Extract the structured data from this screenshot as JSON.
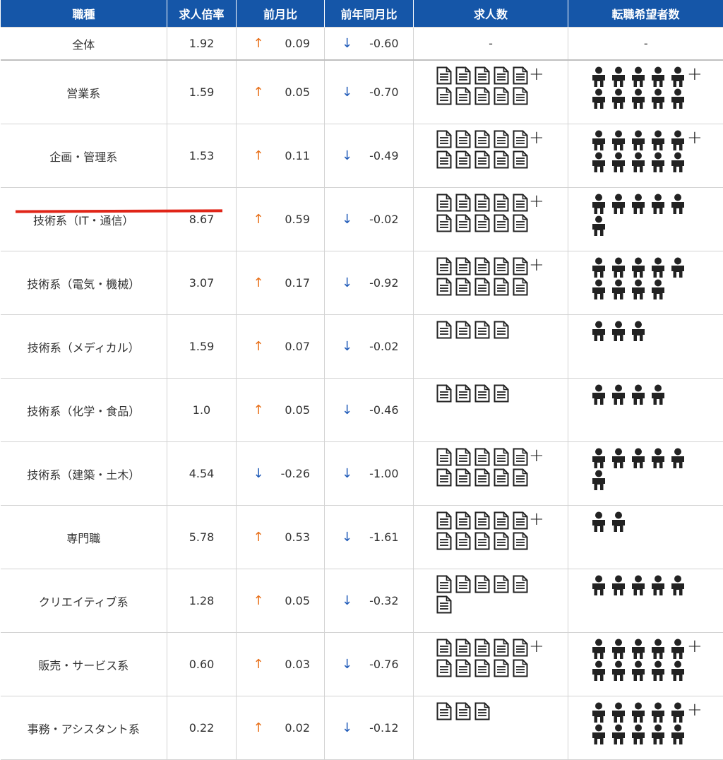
{
  "headers": {
    "job_type": "職種",
    "ratio": "求人倍率",
    "mom": "前月比",
    "yoy": "前年同月比",
    "openings": "求人数",
    "applicants": "転職希望者数"
  },
  "plus_sign": "+",
  "dash": "-",
  "rows": [
    {
      "name": "全体",
      "ratio": "1.92",
      "mom_dir": "up",
      "mom_arrow": "↑",
      "mom": "0.09",
      "yoy_dir": "down",
      "yoy_arrow": "↓",
      "yoy": "-0.60",
      "docs": "-",
      "people": "-"
    },
    {
      "name": "営業系",
      "ratio": "1.59",
      "mom_arrow": "↑",
      "mom": "0.05",
      "yoy_arrow": "↓",
      "yoy": "-0.70",
      "docs": 10,
      "docs_plus": true,
      "people": 10,
      "people_plus": true
    },
    {
      "name": "企画・管理系",
      "ratio": "1.53",
      "mom_arrow": "↑",
      "mom": "0.11",
      "yoy_arrow": "↓",
      "yoy": "-0.49",
      "docs": 10,
      "docs_plus": true,
      "people": 10,
      "people_plus": true
    },
    {
      "name": "技術系（IT・通信）",
      "ratio": "8.67",
      "mom_arrow": "↑",
      "mom": "0.59",
      "yoy_arrow": "↓",
      "yoy": "-0.02",
      "docs": 10,
      "docs_plus": true,
      "people": 6,
      "people_plus": false
    },
    {
      "name": "技術系（電気・機械）",
      "ratio": "3.07",
      "mom_arrow": "↑",
      "mom": "0.17",
      "yoy_arrow": "↓",
      "yoy": "-0.92",
      "docs": 10,
      "docs_plus": true,
      "people": 9,
      "people_plus": false
    },
    {
      "name": "技術系（メディカル）",
      "ratio": "1.59",
      "mom_arrow": "↑",
      "mom": "0.07",
      "yoy_arrow": "↓",
      "yoy": "-0.02",
      "docs": 4,
      "docs_plus": false,
      "people": 3,
      "people_plus": false
    },
    {
      "name": "技術系（化学・食品）",
      "ratio": "1.0",
      "mom_arrow": "↑",
      "mom": "0.05",
      "yoy_arrow": "↓",
      "yoy": "-0.46",
      "docs": 4,
      "docs_plus": false,
      "people": 4,
      "people_plus": false
    },
    {
      "name": "技術系（建築・土木）",
      "ratio": "4.54",
      "mom_arrow": "↓",
      "mom": "-0.26",
      "yoy_arrow": "↓",
      "yoy": "-1.00",
      "docs": 10,
      "docs_plus": true,
      "people": 6,
      "people_plus": false
    },
    {
      "name": "専門職",
      "ratio": "5.78",
      "mom_arrow": "↑",
      "mom": "0.53",
      "yoy_arrow": "↓",
      "yoy": "-1.61",
      "docs": 10,
      "docs_plus": true,
      "people": 2,
      "people_plus": false
    },
    {
      "name": "クリエイティブ系",
      "ratio": "1.28",
      "mom_arrow": "↑",
      "mom": "0.05",
      "yoy_arrow": "↓",
      "yoy": "-0.32",
      "docs": 6,
      "docs_plus": false,
      "people": 5,
      "people_plus": false
    },
    {
      "name": "販売・サービス系",
      "ratio": "0.60",
      "mom_arrow": "↑",
      "mom": "0.03",
      "yoy_arrow": "↓",
      "yoy": "-0.76",
      "docs": 10,
      "docs_plus": true,
      "people": 10,
      "people_plus": true
    },
    {
      "name": "事務・アシスタント系",
      "ratio": "0.22",
      "mom_arrow": "↑",
      "mom": "0.02",
      "yoy_arrow": "↓",
      "yoy": "-0.12",
      "docs": 3,
      "docs_plus": false,
      "people": 10,
      "people_plus": true
    }
  ],
  "colors": {
    "header_bg": "#1556a8",
    "up_arrow": "#e8701a",
    "down_arrow": "#1f5ab8",
    "highlight_underline": "#e02518"
  },
  "highlight": {
    "row": "技術系（IT・通信）",
    "style": "red-underline"
  }
}
